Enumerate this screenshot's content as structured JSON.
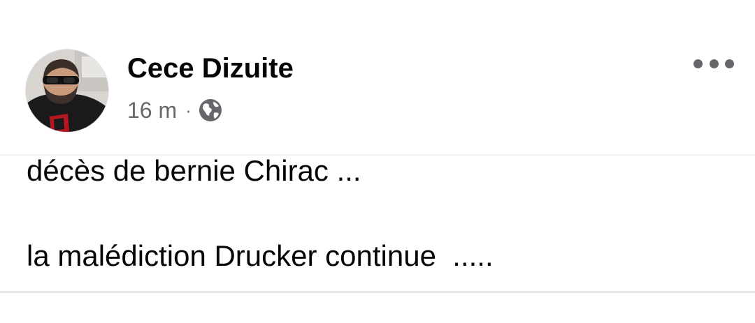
{
  "post": {
    "author": "Cece Dizuite",
    "timestamp": "16 m",
    "separator": "·",
    "privacy_icon": "globe-icon",
    "more_icon": "more-horizontal-icon",
    "lines": [
      "décès de bernie Chirac ...",
      "la malédiction Drucker continue  ....."
    ]
  },
  "colors": {
    "text_primary": "#050505",
    "text_secondary": "#65676b",
    "divider": "#e4e6eb"
  }
}
